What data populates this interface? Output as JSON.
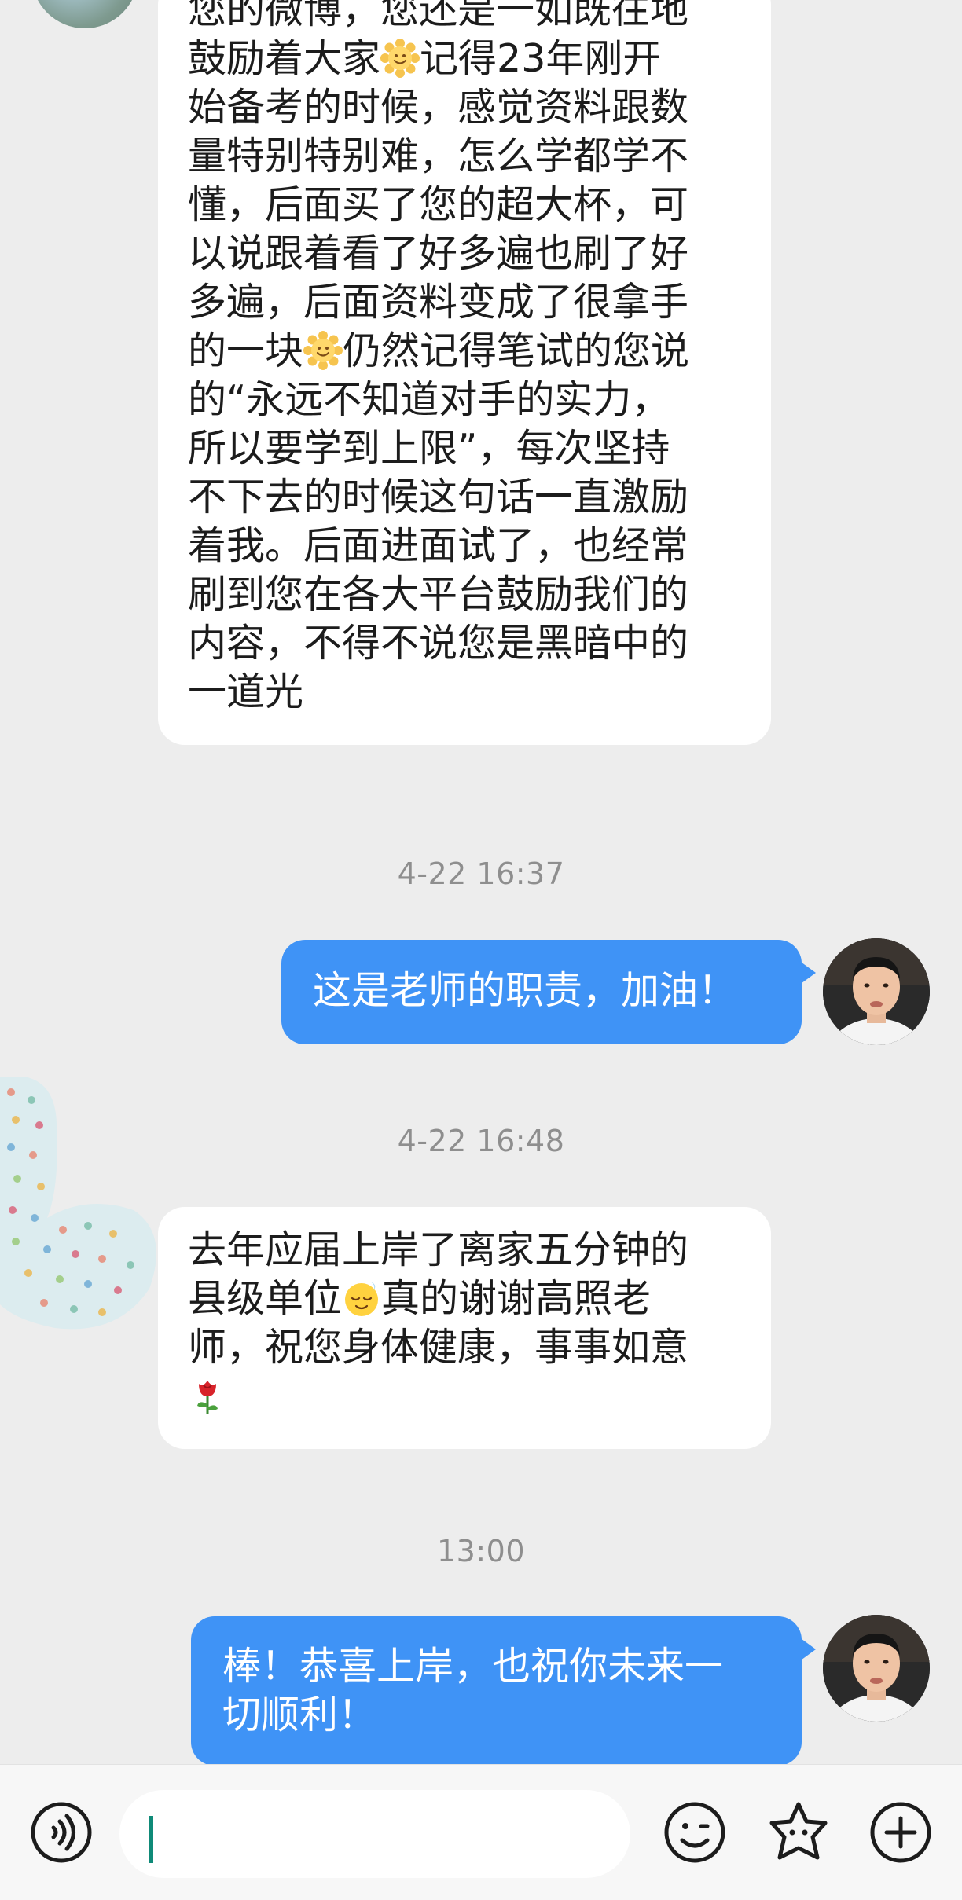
{
  "messages": [
    {
      "side": "left",
      "lines": [
        [
          "您的微博，您还是一如既往地"
        ],
        [
          "鼓励着大家",
          {
            "emoji": "smiling-face-emoji"
          },
          "记得23年刚开"
        ],
        [
          "始备考的时候，感觉资料跟数"
        ],
        [
          "量特别特别难，怎么学都学不"
        ],
        [
          "懂，后面买了您的超大杯，可"
        ],
        [
          "以说跟着看了好多遍也刷了好"
        ],
        [
          "多遍，后面资料变成了很拿手"
        ],
        [
          "的一块",
          {
            "emoji": "smiling-face-emoji"
          },
          "仍然记得笔试的您说"
        ],
        [
          "的“永远不知道对手的实力，"
        ],
        [
          "所以要学到上限”，每次坚持"
        ],
        [
          "不下去的时候这句话一直激励"
        ],
        [
          "着我。后面进面试了，也经常"
        ],
        [
          "刷到您在各大平台鼓励我们的"
        ],
        [
          "内容，不得不说您是黑暗中的"
        ],
        [
          "一道光"
        ]
      ]
    },
    {
      "side": "time",
      "text": "4-22 16:37"
    },
    {
      "side": "right",
      "lines": [
        [
          "这是老师的职责，加油！"
        ]
      ]
    },
    {
      "side": "time",
      "text": "4-22 16:48"
    },
    {
      "side": "left",
      "lines": [
        [
          "去年应届上岸了离家五分钟的"
        ],
        [
          "县级单位",
          {
            "emoji": "relieved-face-emoji"
          },
          "真的谢谢高照老"
        ],
        [
          "师，祝您身体健康，事事如意"
        ],
        [
          {
            "emoji": "rose-emoji"
          }
        ]
      ]
    },
    {
      "side": "time",
      "text": "13:00"
    },
    {
      "side": "right",
      "lines": [
        [
          "棒！恭喜上岸，也祝你未来一"
        ],
        [
          "切顺利！"
        ]
      ]
    }
  ],
  "input_bar": {
    "placeholder": "",
    "icons": [
      "voice-icon",
      "emoji-face-icon",
      "sticker-icon",
      "add-icon"
    ]
  },
  "colors": {
    "background": "#ededed",
    "incoming_bubble": "#ffffff",
    "outgoing_bubble": "#3f93f6",
    "timestamp": "#8e8e8e",
    "caret": "#0f8a78"
  }
}
